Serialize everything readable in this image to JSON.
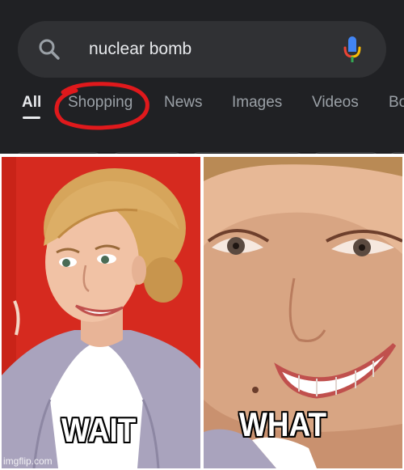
{
  "search": {
    "query": "nuclear bomb"
  },
  "tabs": [
    {
      "label": "All",
      "active": true
    },
    {
      "label": "Shopping",
      "active": false
    },
    {
      "label": "News",
      "active": false
    },
    {
      "label": "Images",
      "active": false
    },
    {
      "label": "Videos",
      "active": false
    },
    {
      "label": "Bo",
      "active": false
    }
  ],
  "annotation": {
    "circle_color": "#e0191c",
    "circled_tab": "Shopping"
  },
  "meme": {
    "left_caption": "WAIT",
    "right_caption": "WHAT",
    "watermark": "imgflip.com"
  },
  "icons": {
    "search": "search-icon",
    "mic": "microphone-icon"
  },
  "colors": {
    "background": "#202124",
    "search_bar": "#303134",
    "text_active": "#e8eaed",
    "text_inactive": "#9aa0a6",
    "left_panel_bg": "#d62a1f"
  }
}
